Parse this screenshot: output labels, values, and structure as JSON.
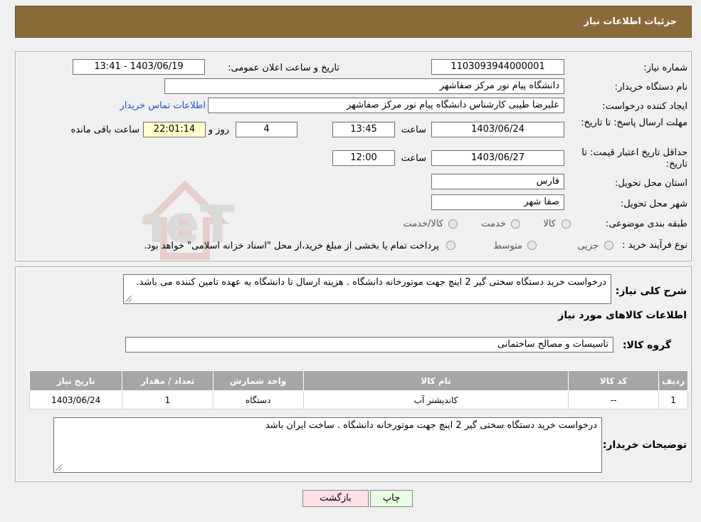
{
  "header": {
    "title": "جزئیات اطلاعات نیاز"
  },
  "watermark": {
    "text": "AriaTender.neT"
  },
  "form": {
    "need_number_label": "شماره نیاز:",
    "need_number": "1103093944000001",
    "announce_label": "تاریخ و ساعت اعلان عمومی:",
    "announce_value": "1403/06/19 - 13:41",
    "buyer_org_label": "نام دستگاه خریدار:",
    "buyer_org": "دانشگاه پیام نور مرکز صفاشهر",
    "creator_label": "ایجاد کننده درخواست:",
    "creator": "علیرضا طیبی کارشناس دانشگاه پیام نور مرکز صفاشهر",
    "contact_link": "اطلاعات تماس خریدار",
    "reply_deadline_label": "مهلت ارسال پاسخ: تا تاریخ:",
    "reply_date": "1403/06/24",
    "time_label": "ساعت",
    "reply_time": "13:45",
    "days_value": "4",
    "days_label": "روز و",
    "remaining_value": "22:01:14",
    "remaining_label": "ساعت باقی مانده",
    "price_validity_label": "حداقل تاریخ اعتبار قیمت: تا تاریخ:",
    "price_date": "1403/06/27",
    "price_time": "12:00",
    "province_label": "استان محل تحویل:",
    "province": "فارس",
    "city_label": "شهر محل تحویل:",
    "city": "صفا شهر",
    "category_label": "طبقه بندی موضوعی:",
    "category_options": [
      "کالا",
      "خدمت",
      "کالا/خدمت"
    ],
    "process_label": "نوع فرآیند خرید :",
    "process_options": [
      "جزیی",
      "متوسط"
    ],
    "process_note": "پرداخت تمام یا بخشی از مبلغ خرید،از محل \"اسناد خزانه اسلامی\" خواهد بود."
  },
  "details": {
    "summary_label": "شرح کلی نیاز:",
    "summary": "درخواست خرید دستگاه سختی گیر 2 اینچ جهت موتورخانه دانشگاه . هزینه ارسال تا دانشگاه به عهده تامین کننده می باشد.",
    "goods_info_title": "اطلاعات کالاهای مورد نیاز",
    "goods_group_label": "گروه کالا:",
    "goods_group": "تاسیسات و مصالح ساختمانی",
    "table": {
      "headers": [
        "ردیف",
        "کد کالا",
        "نام کالا",
        "واحد شمارش",
        "تعداد / مقدار",
        "تاریخ نیاز"
      ],
      "rows": [
        [
          "1",
          "--",
          "کاندیشنر آب",
          "دستگاه",
          "1",
          "1403/06/24"
        ]
      ]
    },
    "buyer_notes_label": "توضیحات خریدار:",
    "buyer_notes": "درخواست خرید دستگاه سختی گیر 2 اینچ جهت موتورخانه دانشگاه . ساخت ایران باشد"
  },
  "buttons": {
    "print": "چاپ",
    "back": "بازگشت"
  },
  "colors": {
    "header": "#8b6a3a",
    "link": "#1a4fd6",
    "table_header": "#a6a6a6"
  }
}
